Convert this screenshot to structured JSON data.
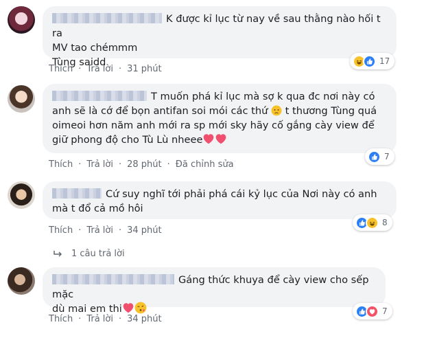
{
  "comments": [
    {
      "text_lines": [
        "K được kỉ lục từ nay về sau thằng nào hối t ra",
        "MV tao chémmm",
        "Tùng saidd"
      ],
      "actions": {
        "like": "Thích",
        "reply": "Trả lời",
        "time": "31 phút"
      },
      "reactions": {
        "icons": [
          "haha-icon",
          "like-icon"
        ],
        "count": "17"
      }
    },
    {
      "text_lines": [
        "T muốn phá kỉ lục mà sợ k qua đc nơi này có",
        "anh sẽ là cớ để bọn antifan soi mói các thứ",
        "t thương Tùng quá",
        "oimeoi hơn năm anh mới ra sp mới sky hãy cố gắng cày view để",
        "giữ phong độ cho Tù Lù nheee"
      ],
      "actions": {
        "like": "Thích",
        "reply": "Trả lời",
        "time": "28 phút",
        "edited": "Đã chỉnh sửa"
      },
      "reactions": {
        "icons": [
          "like-icon"
        ],
        "count": "7"
      }
    },
    {
      "text_lines": [
        "Cứ suy nghĩ tới phải phá cái kỷ lục của Nơi này có anh",
        "mà t đổ cả mồ hôi"
      ],
      "actions": {
        "like": "Thích",
        "reply": "Trả lời",
        "time": "34 phút"
      },
      "reactions": {
        "icons": [
          "like-icon",
          "haha-icon"
        ],
        "count": "8"
      },
      "replies_label": "1 câu trả lời"
    },
    {
      "text_lines": [
        "Gáng thức khuya để cày view cho sếp mặc",
        "dù mai em thi"
      ],
      "actions": {
        "like": "Thích",
        "reply": "Trả lời",
        "time": "34 phút"
      },
      "reactions": {
        "icons": [
          "like-icon",
          "love-icon"
        ],
        "count": "7"
      }
    }
  ],
  "colors": {
    "bubble": "#f2f3f5",
    "meta": "#606770",
    "like": "#2d7ff6",
    "love": "#f35369",
    "haha": "#f7c22c"
  }
}
